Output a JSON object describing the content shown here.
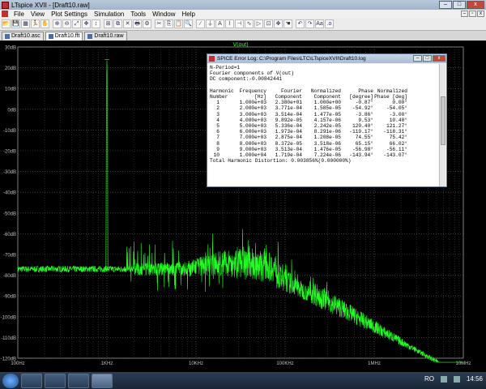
{
  "window": {
    "title": "LTspice XVII - [Draft10.raw]",
    "min": "–",
    "max": "□",
    "close": "x"
  },
  "menu": [
    "File",
    "View",
    "Plot Settings",
    "Simulation",
    "Tools",
    "Window",
    "Help"
  ],
  "toolbar_icons": [
    "open-icon",
    "save-icon",
    "control-panel-icon",
    "run-icon",
    "halt-icon",
    "zoom-in-icon",
    "zoom-out-icon",
    "zoom-fit-icon",
    "pan-icon",
    "autorange-icon",
    "tile-icon",
    "cascade-icon",
    "close-icon",
    "print-icon",
    "setup-icon",
    "cut-icon",
    "copy-icon",
    "paste-icon",
    "find-icon",
    "wire-icon",
    "ground-icon",
    "label-icon",
    "resistor-icon",
    "capacitor-icon",
    "inductor-icon",
    "diode-icon",
    "component-icon",
    "move-icon",
    "drag-icon",
    "undo-icon",
    "redo-icon",
    "text-icon",
    "spice-directive-icon"
  ],
  "tabs": [
    {
      "label": "Draft10.asc",
      "active": false
    },
    {
      "label": "Draft10.fft",
      "active": true
    },
    {
      "label": "Draft10.raw",
      "active": false
    }
  ],
  "plot": {
    "trace_name": "V(out)",
    "trace_color": "#22ff22",
    "y_ticks": [
      "30dB",
      "20dB",
      "10dB",
      "0dB",
      "-10dB",
      "-20dB",
      "-30dB",
      "-40dB",
      "-50dB",
      "-60dB",
      "-70dB",
      "-80dB",
      "-90dB",
      "-100dB",
      "-110dB",
      "-120dB"
    ],
    "x_ticks": [
      "100Hz",
      "1KHz",
      "10KHz",
      "100KHz",
      "1MHz",
      "10MHz"
    ],
    "y_range": [
      -120,
      30
    ],
    "x_decades": [
      2,
      7
    ]
  },
  "error_log": {
    "title": "SPICE Error Log: C:\\Program Files\\LTC\\LTspiceXVII\\Draft10.log",
    "lines_top": [
      "N-Period=1",
      "Fourier components of V(out)",
      "DC component:-0.00842441"
    ],
    "header1": [
      "Harmonic",
      "Frequency",
      "Fourier",
      "Normalized",
      "Phase",
      "Normalized"
    ],
    "header2": [
      "Number",
      "[Hz]",
      "Component",
      "Component",
      "[degree]",
      "Phase [deg]"
    ],
    "rows": [
      [
        "1",
        "1.000e+03",
        "2.380e+01",
        "1.000e+00",
        "-0.87°",
        "0.00°"
      ],
      [
        "2",
        "2.000e+03",
        "3.771e-04",
        "1.585e-05",
        "-54.92°",
        "-54.05°"
      ],
      [
        "3",
        "3.000e+03",
        "3.514e-04",
        "1.477e-05",
        "-3.86°",
        "-3.00°"
      ],
      [
        "4",
        "4.000e+03",
        "9.892e-05",
        "4.157e-06",
        "9.53°",
        "10.40°"
      ],
      [
        "5",
        "5.000e+03",
        "5.336e-04",
        "2.242e-05",
        "120.40°",
        "121.27°"
      ],
      [
        "6",
        "6.000e+03",
        "1.973e-04",
        "8.291e-06",
        "-119.17°",
        "-118.31°"
      ],
      [
        "7",
        "7.000e+03",
        "2.875e-04",
        "1.208e-05",
        "74.55°",
        "75.42°"
      ],
      [
        "8",
        "8.000e+03",
        "8.372e-05",
        "3.518e-06",
        "65.15°",
        "66.02°"
      ],
      [
        "9",
        "9.000e+03",
        "3.513e-04",
        "1.476e-05",
        "-56.98°",
        "-56.11°"
      ],
      [
        "10",
        "1.000e+04",
        "1.719e-04",
        "7.224e-06",
        "-143.94°",
        "-143.07°"
      ]
    ],
    "thd": "Total Harmonic Distortion: 0.003856%(0.000000%)"
  },
  "taskbar": {
    "lang": "RO",
    "time": "14:56"
  }
}
